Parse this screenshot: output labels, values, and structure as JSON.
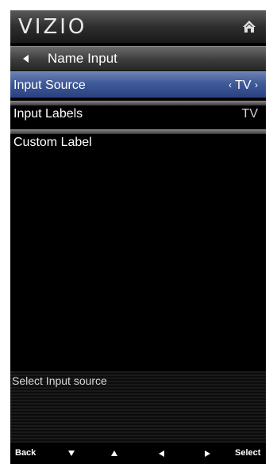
{
  "header": {
    "brand": "VIZIO",
    "home_icon": "home-icon"
  },
  "subheader": {
    "back_icon": "back-arrow-icon",
    "title": "Name Input"
  },
  "menu": {
    "items": [
      {
        "label": "Input Source",
        "value": "TV",
        "selected": true,
        "left_chevron": "‹",
        "right_chevron": "›"
      },
      {
        "label": "Input Labels",
        "value": "TV",
        "selected": false
      },
      {
        "label": "Custom Label",
        "value": "",
        "selected": false
      }
    ]
  },
  "help": {
    "text": "Select Input source"
  },
  "footer": {
    "back_label": "Back",
    "select_label": "Select",
    "down_icon": "down-arrow-icon",
    "up_icon": "up-arrow-icon",
    "left_icon": "left-arrow-icon",
    "right_icon": "right-arrow-icon"
  },
  "colors": {
    "selected_highlight": "#3f5a99",
    "background": "#000000",
    "text": "#ffffff"
  }
}
